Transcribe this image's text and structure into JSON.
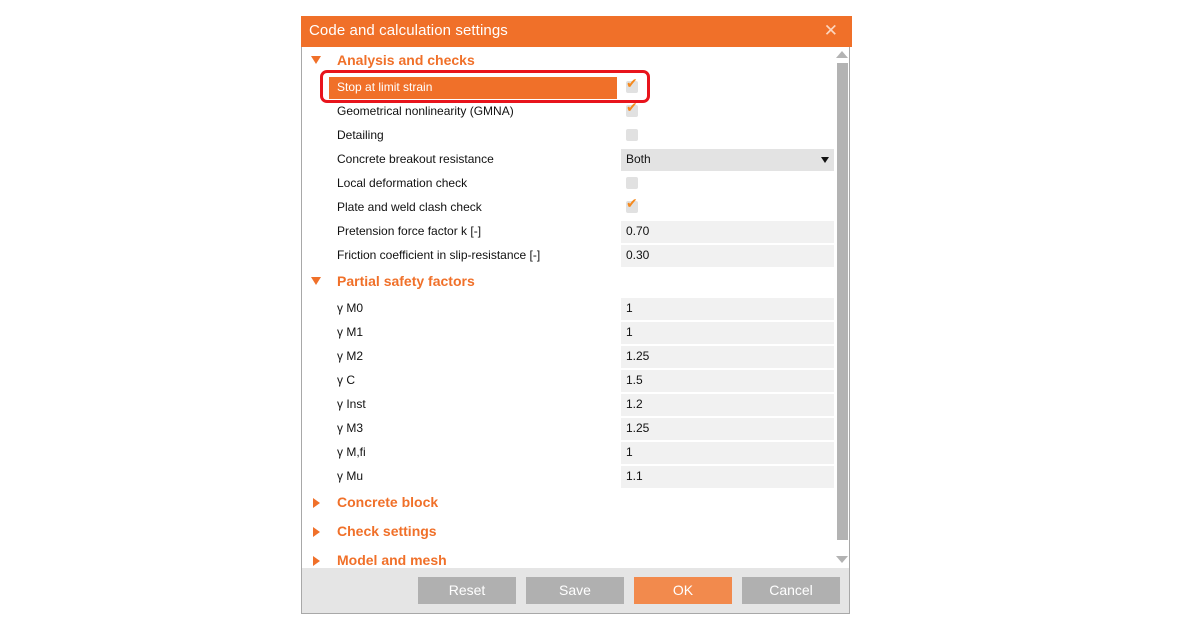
{
  "dialog": {
    "title": "Code and calculation settings",
    "close_icon": "close-icon"
  },
  "sections": [
    {
      "label": "Analysis and checks",
      "expanded": true,
      "rows": [
        {
          "label": "Stop at limit strain",
          "type": "checkbox",
          "checked": true,
          "selected": true
        },
        {
          "label": "Geometrical nonlinearity (GMNA)",
          "type": "checkbox",
          "checked": true
        },
        {
          "label": "Detailing",
          "type": "checkbox",
          "checked": false
        },
        {
          "label": "Concrete breakout resistance",
          "type": "select",
          "value": "Both"
        },
        {
          "label": "Local deformation check",
          "type": "checkbox",
          "checked": false
        },
        {
          "label": "Plate and weld clash check",
          "type": "checkbox",
          "checked": true
        },
        {
          "label": "Pretension force factor k [-]",
          "type": "value",
          "value": "0.70"
        },
        {
          "label": "Friction coefficient in slip-resistance [-]",
          "type": "value",
          "value": "0.30"
        }
      ]
    },
    {
      "label": "Partial safety factors",
      "expanded": true,
      "rows": [
        {
          "label": "γ M0",
          "type": "value",
          "value": "1"
        },
        {
          "label": "γ M1",
          "type": "value",
          "value": "1"
        },
        {
          "label": "γ M2",
          "type": "value",
          "value": "1.25"
        },
        {
          "label": "γ C",
          "type": "value",
          "value": "1.5"
        },
        {
          "label": "γ Inst",
          "type": "value",
          "value": "1.2"
        },
        {
          "label": "γ M3",
          "type": "value",
          "value": "1.25"
        },
        {
          "label": "γ M,fi",
          "type": "value",
          "value": "1"
        },
        {
          "label": "γ Mu",
          "type": "value",
          "value": "1.1"
        }
      ]
    },
    {
      "label": "Concrete block",
      "expanded": false
    },
    {
      "label": "Check settings",
      "expanded": false
    },
    {
      "label": "Model and mesh",
      "expanded": false
    }
  ],
  "checkmark_glyph": "✔",
  "footer": {
    "reset_label": "Reset",
    "save_label": "Save",
    "ok_label": "OK",
    "cancel_label": "Cancel"
  },
  "colors": {
    "accent": "#f07029",
    "ok_button": "#f28a4d",
    "button": "#b0b0b0",
    "highlight_border": "#e8141c"
  }
}
